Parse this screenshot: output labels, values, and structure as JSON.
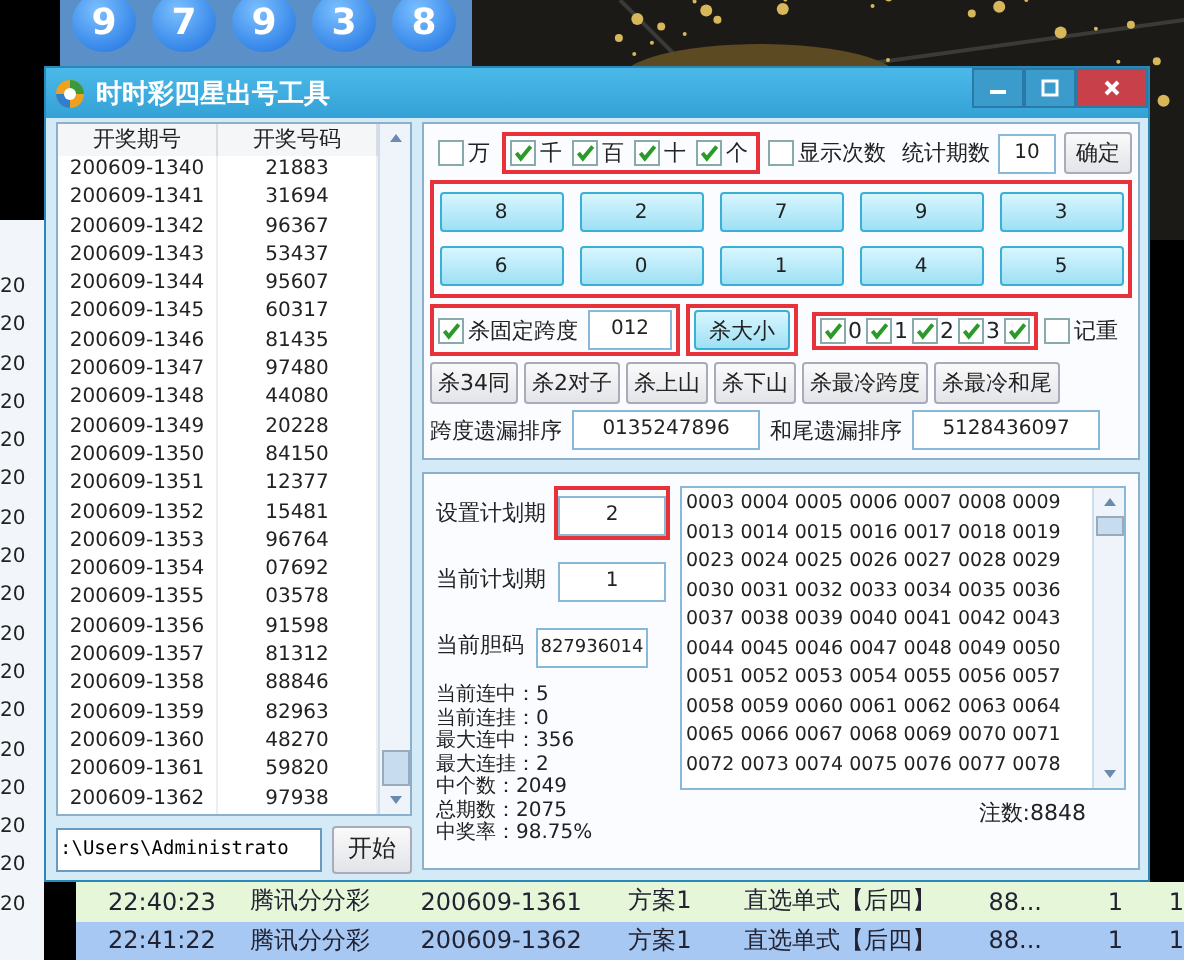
{
  "background": {
    "balls": [
      "9",
      "7",
      "9",
      "3",
      "8"
    ],
    "side_rows": [
      "20",
      "20",
      "20",
      "20",
      "20",
      "20",
      "20",
      "20",
      "20",
      "20",
      "20",
      "20",
      "20",
      "20",
      "20",
      "20",
      "20"
    ],
    "history_rows": [
      {
        "selected": false,
        "cells": [
          "22:40:23",
          "腾讯分分彩",
          "200609-1361",
          "方案1",
          "直选单式【后四】",
          "88...",
          "1",
          "1"
        ]
      },
      {
        "selected": true,
        "cells": [
          "22:41:22",
          "腾讯分分彩",
          "200609-1362",
          "方案1",
          "直选单式【后四】",
          "88...",
          "1",
          "1"
        ]
      }
    ]
  },
  "window": {
    "title": "时时彩四星出号工具"
  },
  "draw_list": {
    "columns": [
      "开奖期号",
      "开奖号码"
    ],
    "rows": [
      [
        "200609-1340",
        "21883"
      ],
      [
        "200609-1341",
        "31694"
      ],
      [
        "200609-1342",
        "96367"
      ],
      [
        "200609-1343",
        "53437"
      ],
      [
        "200609-1344",
        "95607"
      ],
      [
        "200609-1345",
        "60317"
      ],
      [
        "200609-1346",
        "81435"
      ],
      [
        "200609-1347",
        "97480"
      ],
      [
        "200609-1348",
        "44080"
      ],
      [
        "200609-1349",
        "20228"
      ],
      [
        "200609-1350",
        "84150"
      ],
      [
        "200609-1351",
        "12377"
      ],
      [
        "200609-1352",
        "15481"
      ],
      [
        "200609-1353",
        "96764"
      ],
      [
        "200609-1354",
        "07692"
      ],
      [
        "200609-1355",
        "03578"
      ],
      [
        "200609-1356",
        "91598"
      ],
      [
        "200609-1357",
        "81312"
      ],
      [
        "200609-1358",
        "88846"
      ],
      [
        "200609-1359",
        "82963"
      ],
      [
        "200609-1360",
        "48270"
      ],
      [
        "200609-1361",
        "59820"
      ],
      [
        "200609-1362",
        "97938"
      ]
    ]
  },
  "path_field": {
    "value": ":\\Users\\Administrato"
  },
  "start_button": "开始",
  "position_groups": [
    {
      "marked": false,
      "items": [
        {
          "label": "万",
          "checked": false
        }
      ]
    },
    {
      "marked": true,
      "items": [
        {
          "label": "千",
          "checked": true
        },
        {
          "label": "百",
          "checked": true
        },
        {
          "label": "十",
          "checked": true
        },
        {
          "label": "个",
          "checked": true
        }
      ]
    }
  ],
  "show_count": {
    "label": "显示次数",
    "checked": false
  },
  "stat_periods": {
    "label": "统计期数",
    "value": "10"
  },
  "confirm_button": "确定",
  "number_grid": {
    "marked": true,
    "rows": [
      [
        "8",
        "2",
        "7",
        "9",
        "3"
      ],
      [
        "6",
        "0",
        "1",
        "4",
        "5"
      ]
    ]
  },
  "fixed_span": {
    "label": "杀固定跨度",
    "checked": true,
    "value": "012",
    "marked": true
  },
  "kill_size_button": {
    "label": "杀大小",
    "marked": true
  },
  "digit_checks": {
    "marked": true,
    "items": [
      {
        "label": "0",
        "checked": true
      },
      {
        "label": "1",
        "checked": true
      },
      {
        "label": "2",
        "checked": true
      },
      {
        "label": "3",
        "checked": true
      },
      {
        "checked": true
      }
    ]
  },
  "remember": {
    "label": "记重",
    "checked": false
  },
  "kill_buttons": [
    "杀34同",
    "杀2对子",
    "杀上山",
    "杀下山",
    "杀最冷跨度",
    "杀最冷和尾"
  ],
  "miss_fields": [
    {
      "label": "跨度遗漏排序",
      "value": "0135247896"
    },
    {
      "label": "和尾遗漏排序",
      "value": "5128436097"
    }
  ],
  "plan_fields": [
    {
      "label": "设置计划期",
      "value": "2",
      "marked": true,
      "kind": "input"
    },
    {
      "label": "当前计划期",
      "value": "1",
      "marked": false,
      "kind": "input"
    },
    {
      "label": "当前胆码",
      "value": "827936014",
      "marked": false,
      "kind": "code"
    }
  ],
  "stats": [
    "当前连中：5",
    "当前连挂：0",
    "最大连中：356",
    "最大连挂：2",
    "中个数：2049",
    "总期数：2075",
    "中奖率：98.75%"
  ],
  "results": [
    "0003 0004 0005 0006 0007 0008 0009",
    "0013 0014 0015 0016 0017 0018 0019",
    "0023 0024 0025 0026 0027 0028 0029",
    "0030 0031 0032 0033 0034 0035 0036",
    "0037 0038 0039 0040 0041 0042 0043",
    "0044 0045 0046 0047 0048 0049 0050",
    "0051 0052 0053 0054 0055 0056 0057",
    "0058 0059 0060 0061 0062 0063 0064",
    "0065 0066 0067 0068 0069 0070 0071",
    "0072 0073 0074 0075 0076 0077 0078"
  ],
  "note_count": "注数:8848"
}
